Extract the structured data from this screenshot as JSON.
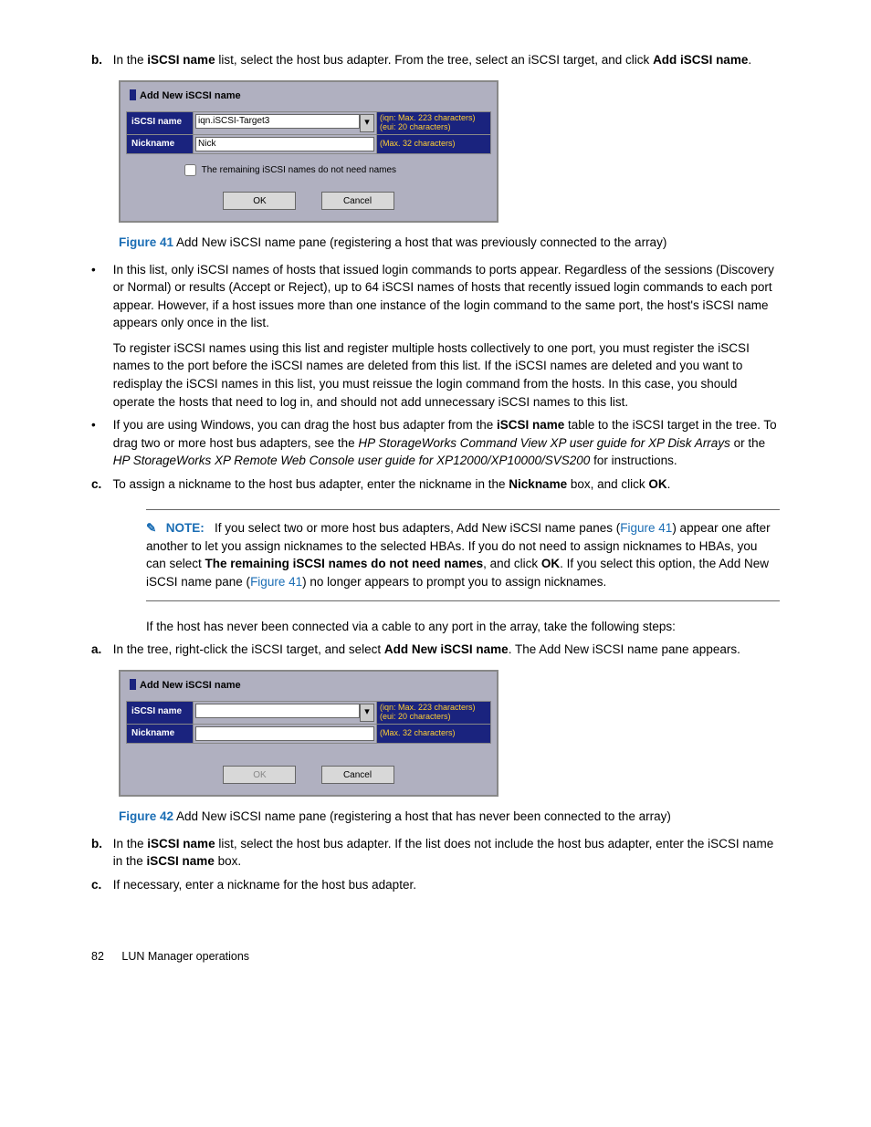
{
  "step_b": {
    "label": "b.",
    "pre": "In the ",
    "bold1": "iSCSI name",
    "mid": " list, select the host bus adapter. From the tree, select an iSCSI target, and click ",
    "bold2": "Add iSCSI name",
    "post": "."
  },
  "dlg1": {
    "title": "Add New iSCSI name",
    "row1_label": "iSCSI name",
    "row1_value": "iqn.iSCSI-Target3",
    "row1_hint": "(iqn: Max. 223 characters)\n(eui: 20 characters)",
    "row2_label": "Nickname",
    "row2_value": "Nick",
    "row2_hint": "(Max. 32 characters)",
    "chk_label": "The remaining iSCSI names do not need names",
    "ok": "OK",
    "cancel": "Cancel"
  },
  "fig41": {
    "label": "Figure 41",
    "caption": "  Add New iSCSI name pane (registering a host that was previously connected to the array)"
  },
  "bullet1": "In this list, only iSCSI names of hosts that issued login commands to ports appear. Regardless of the sessions (Discovery or Normal) or results (Accept or Reject), up to 64 iSCSI names of hosts that recently issued login commands to each port appear. However, if a host issues more than one instance of the login command to the same port, the host's iSCSI name appears only once in the list.",
  "bullet1b": "To register iSCSI names using this list and register multiple hosts collectively to one port, you must register the iSCSI names to the port before the iSCSI names are deleted from this list. If the iSCSI names are deleted and you want to redisplay the iSCSI names in this list, you must reissue the login command from the hosts. In this case, you should operate the hosts that need to log in, and should not add unnecessary iSCSI names to this list.",
  "bullet2": {
    "pre": "If you are using Windows, you can drag the host bus adapter from the ",
    "b1": "iSCSI name",
    "mid1": " table to the iSCSI target in the tree. To drag two or more host bus adapters, see the ",
    "i1": "HP StorageWorks Command View XP user guide for XP Disk Arrays",
    "mid2": " or the ",
    "i2": "HP StorageWorks XP Remote Web Console user guide for XP12000/XP10000/SVS200",
    "post": " for instructions."
  },
  "step_c": {
    "label": "c.",
    "pre": "To assign a nickname to the host bus adapter, enter the nickname in the ",
    "b1": "Nickname",
    "mid": " box, and click ",
    "b2": "OK",
    "post": "."
  },
  "note": {
    "label": "NOTE:",
    "t1": "If you select two or more host bus adapters, Add New iSCSI name panes (",
    "l1": "Figure 41",
    "t2": ") appear one after another to let you assign nicknames to the selected HBAs. If you do not need to assign nicknames to HBAs, you can select ",
    "b1": "The remaining iSCSI names do not need names",
    "t3": ", and click ",
    "b2": "OK",
    "t4": ". If you select this option, the Add New iSCSI name pane (",
    "l2": "Figure 41",
    "t5": ") no longer appears to prompt you to assign nicknames."
  },
  "para_new": "If the host has never been connected via a cable to any port in the array, take the following steps:",
  "step_a2": {
    "label": "a.",
    "pre": "In the tree, right-click the iSCSI target, and select ",
    "b1": "Add New iSCSI name",
    "post": ". The Add New iSCSI name pane appears."
  },
  "dlg2": {
    "title": "Add New iSCSI name",
    "row1_label": "iSCSI name",
    "row1_value": "",
    "row1_hint": "(iqn: Max. 223 characters)\n(eui: 20 characters)",
    "row2_label": "Nickname",
    "row2_value": "",
    "row2_hint": "(Max. 32 characters)",
    "ok": "OK",
    "cancel": "Cancel"
  },
  "fig42": {
    "label": "Figure 42",
    "caption": "  Add New iSCSI name pane (registering a host that has never been connected to the array)"
  },
  "step_b2": {
    "label": "b.",
    "pre": "In the ",
    "b1": "iSCSI name",
    "mid": " list, select the host bus adapter. If the list does not include the host bus adapter, enter the iSCSI name in the ",
    "b2": "iSCSI name",
    "post": " box."
  },
  "step_c2": {
    "label": "c.",
    "text": "If necessary, enter a nickname for the host bus adapter."
  },
  "footer": {
    "page": "82",
    "section": "LUN Manager operations"
  }
}
